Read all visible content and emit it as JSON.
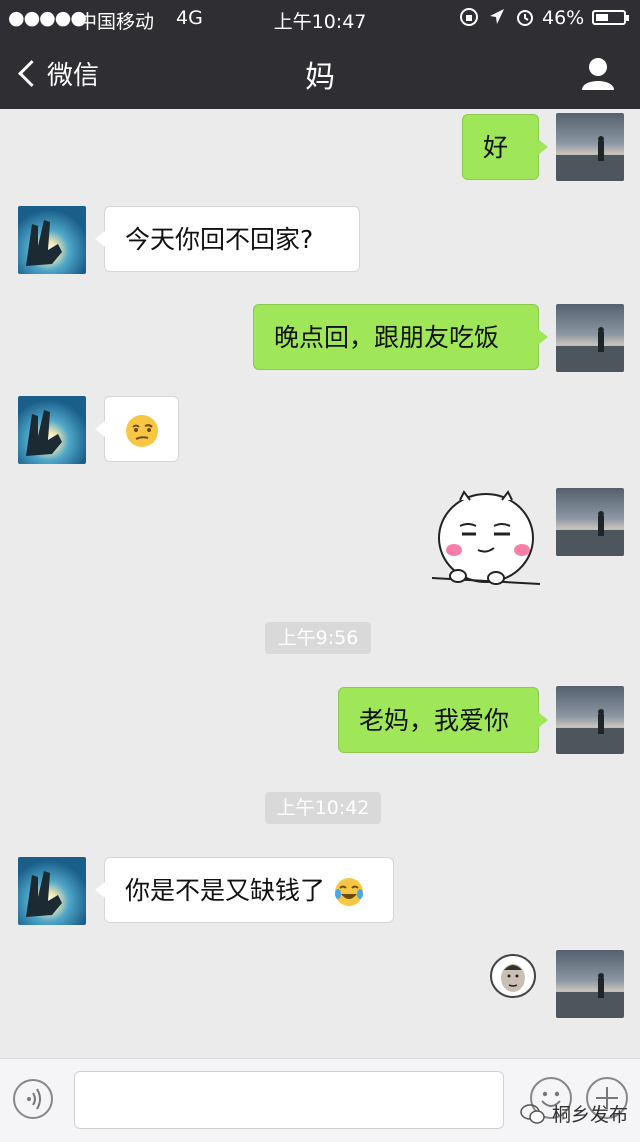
{
  "status_bar": {
    "signal": "●●●●●",
    "carrier": "中国移动",
    "network": "4G",
    "time": "上午10:47",
    "battery_percent": "46%",
    "battery_level": 0.46
  },
  "nav": {
    "back_label": "微信",
    "title": "妈"
  },
  "messages": {
    "m1": "好",
    "m2": "今天你回不回家?",
    "m3": "晚点回，跟朋友吃饭",
    "m5_emoji": "thinking-face-emoji",
    "m6_sticker": "shy-ball-sticker",
    "ts1": "上午9:56",
    "m7": "老妈，我爱你",
    "ts2": "上午10:42",
    "m8": "你是不是又缺钱了",
    "m8_emoji": "crying-laughing-emoji",
    "m9_sticker": "face-sticker"
  },
  "bottom": {
    "voice_icon": "voice-icon",
    "emoji_icon": "emoji-icon",
    "plus_icon": "plus-icon"
  },
  "watermark": {
    "text": "桐乡发布"
  },
  "colors": {
    "header_bg": "#2f2f33",
    "chat_bg": "#ebebeb",
    "out_bubble": "#9fe658",
    "in_bubble": "#ffffff"
  }
}
